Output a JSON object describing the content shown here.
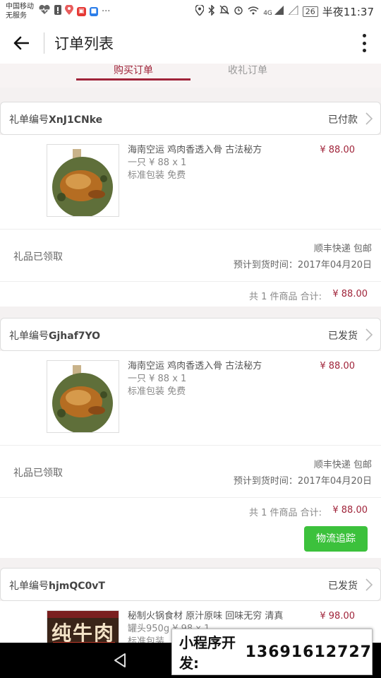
{
  "status_bar": {
    "carrier_line1": "中国移动",
    "carrier_line2": "无服务",
    "battery": "26",
    "time": "半夜11:37",
    "signal_label": "4G"
  },
  "appbar": {
    "title": "订单列表"
  },
  "tabs": [
    {
      "label": "购买订单",
      "active": true
    },
    {
      "label": "收礼订单",
      "active": false
    }
  ],
  "orders": [
    {
      "id_prefix": "礼单编号",
      "id": "XnJ1CNke",
      "status": "已付款",
      "item_name": "海南空运 鸡肉香透入骨 古法秘方",
      "item_qty": "一只 ¥ 88 x 1",
      "item_pack": "标准包装 免费",
      "item_price": "¥ 88.00",
      "gift_status": "礼品已领取",
      "shipping": "顺丰快递 包邮",
      "eta": "预计到货时间：2017年04月20日",
      "summary": "共 1 件商品 合计:",
      "total": "¥ 88.00"
    },
    {
      "id_prefix": "礼单编号",
      "id": "Gjhaf7YO",
      "status": "已发货",
      "item_name": "海南空运 鸡肉香透入骨 古法秘方",
      "item_qty": "一只 ¥ 88 x 1",
      "item_pack": "标准包装 免费",
      "item_price": "¥ 88.00",
      "gift_status": "礼品已领取",
      "shipping": "顺丰快递 包邮",
      "eta": "预计到货时间：2017年04月20日",
      "summary": "共 1 件商品 合计:",
      "total": "¥ 88.00",
      "track_button": "物流追踪"
    },
    {
      "id_prefix": "礼单编号",
      "id": "hjmQC0vT",
      "status": "已发货",
      "item_name": "秘制火锅食材 原汁原味 回味无穷 清真",
      "item_qty": "罐头950g ¥ 98 x 1",
      "item_pack": "标准包装",
      "item_price": "¥ 98.00",
      "product_image_text": "纯牛肉"
    }
  ],
  "ad": {
    "label": "小程序开发:",
    "phone": "13691612727"
  },
  "colors": {
    "accent": "#a0243a",
    "button_green": "#3cc13c"
  }
}
